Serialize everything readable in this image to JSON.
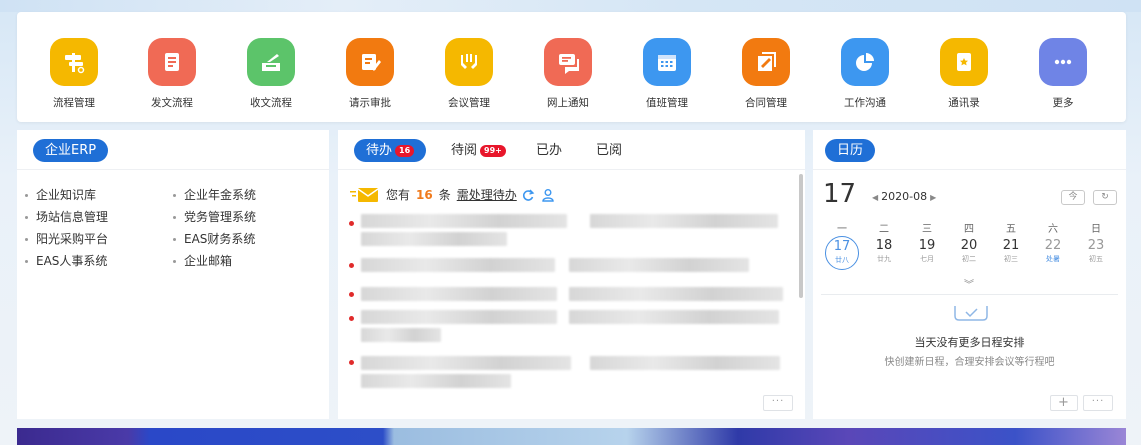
{
  "apps": [
    {
      "label": "流程管理",
      "icon": "signpost-icon",
      "color": "#f5b800"
    },
    {
      "label": "发文流程",
      "icon": "document-icon",
      "color": "#f06a55"
    },
    {
      "label": "收文流程",
      "icon": "inbox-icon",
      "color": "#5cc46a"
    },
    {
      "label": "请示审批",
      "icon": "edit-icon",
      "color": "#f27a10"
    },
    {
      "label": "会议管理",
      "icon": "meeting-icon",
      "color": "#f5b800"
    },
    {
      "label": "网上通知",
      "icon": "chat-icon",
      "color": "#f06a55"
    },
    {
      "label": "值班管理",
      "icon": "calendar-icon",
      "color": "#3d97f0"
    },
    {
      "label": "合同管理",
      "icon": "contract-icon",
      "color": "#f27a10"
    },
    {
      "label": "工作沟通",
      "icon": "pie-icon",
      "color": "#3d97f0"
    },
    {
      "label": "通讯录",
      "icon": "contacts-icon",
      "color": "#f5b800"
    },
    {
      "label": "更多",
      "icon": "more-icon",
      "color": "#6f84e6"
    }
  ],
  "erp": {
    "title": "企业ERP",
    "col1": [
      "企业知识库",
      "场站信息管理",
      "阳光采购平台",
      "EAS人事系统"
    ],
    "col2": [
      "企业年金系统",
      "党务管理系统",
      "EAS财务系统",
      "企业邮箱"
    ]
  },
  "todo": {
    "tabs": [
      {
        "label": "待办",
        "badge": "16"
      },
      {
        "label": "待阅",
        "badge": "99+"
      },
      {
        "label": "已办"
      },
      {
        "label": "已阅"
      }
    ],
    "notice_prefix": "您有",
    "count": "16",
    "notice_unit": "条",
    "notice_link": "需处理待办",
    "more": "···"
  },
  "calendar": {
    "title": "日历",
    "day": "17",
    "month": "2020-08",
    "today_btn": "今",
    "refresh_btn": "↻",
    "weekdays": [
      "一",
      "二",
      "三",
      "四",
      "五",
      "六",
      "日"
    ],
    "dates": [
      {
        "n": "17",
        "l": "廿八"
      },
      {
        "n": "18",
        "l": "廿九"
      },
      {
        "n": "19",
        "l": "七月"
      },
      {
        "n": "20",
        "l": "初二"
      },
      {
        "n": "21",
        "l": "初三"
      },
      {
        "n": "22",
        "l": "处暑"
      },
      {
        "n": "23",
        "l": "初五"
      }
    ],
    "empty_title": "当天没有更多日程安排",
    "empty_sub": "快创建新日程，合理安排会议等行程吧",
    "add": "+",
    "more": "···"
  },
  "colors": {
    "accent": "#1f6fd6",
    "badge": "#e8162b",
    "count": "#f07a1c"
  }
}
